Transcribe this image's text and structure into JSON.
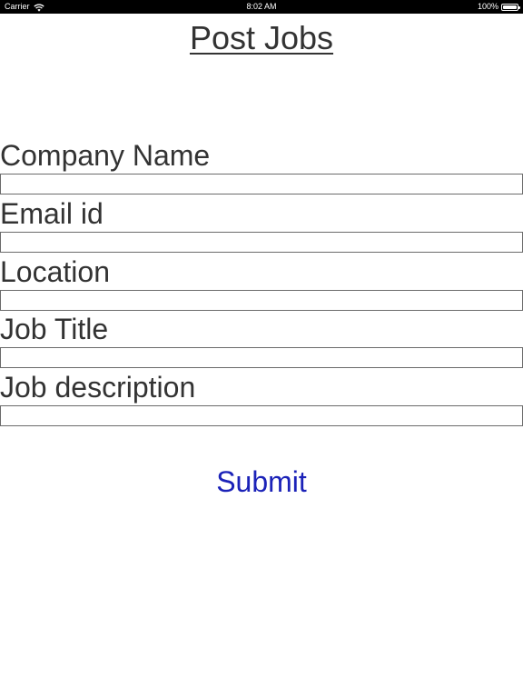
{
  "status_bar": {
    "carrier": "Carrier",
    "time": "8:02 AM",
    "battery": "100%"
  },
  "page": {
    "title": "Post Jobs"
  },
  "form": {
    "fields": [
      {
        "label": "Company Name",
        "value": "",
        "placeholder": ""
      },
      {
        "label": "Email id",
        "value": "",
        "placeholder": ""
      },
      {
        "label": "Location",
        "value": "",
        "placeholder": ""
      },
      {
        "label": "Job Title",
        "value": "",
        "placeholder": ""
      },
      {
        "label": "Job description",
        "value": "",
        "placeholder": ""
      }
    ],
    "submit_label": "Submit"
  },
  "colors": {
    "status_bar_bg": "#000000",
    "text": "#333333",
    "input_border": "#6b6b6b",
    "submit_text": "#1b22b8"
  },
  "icons": {
    "wifi": "wifi-icon",
    "battery": "battery-icon"
  }
}
